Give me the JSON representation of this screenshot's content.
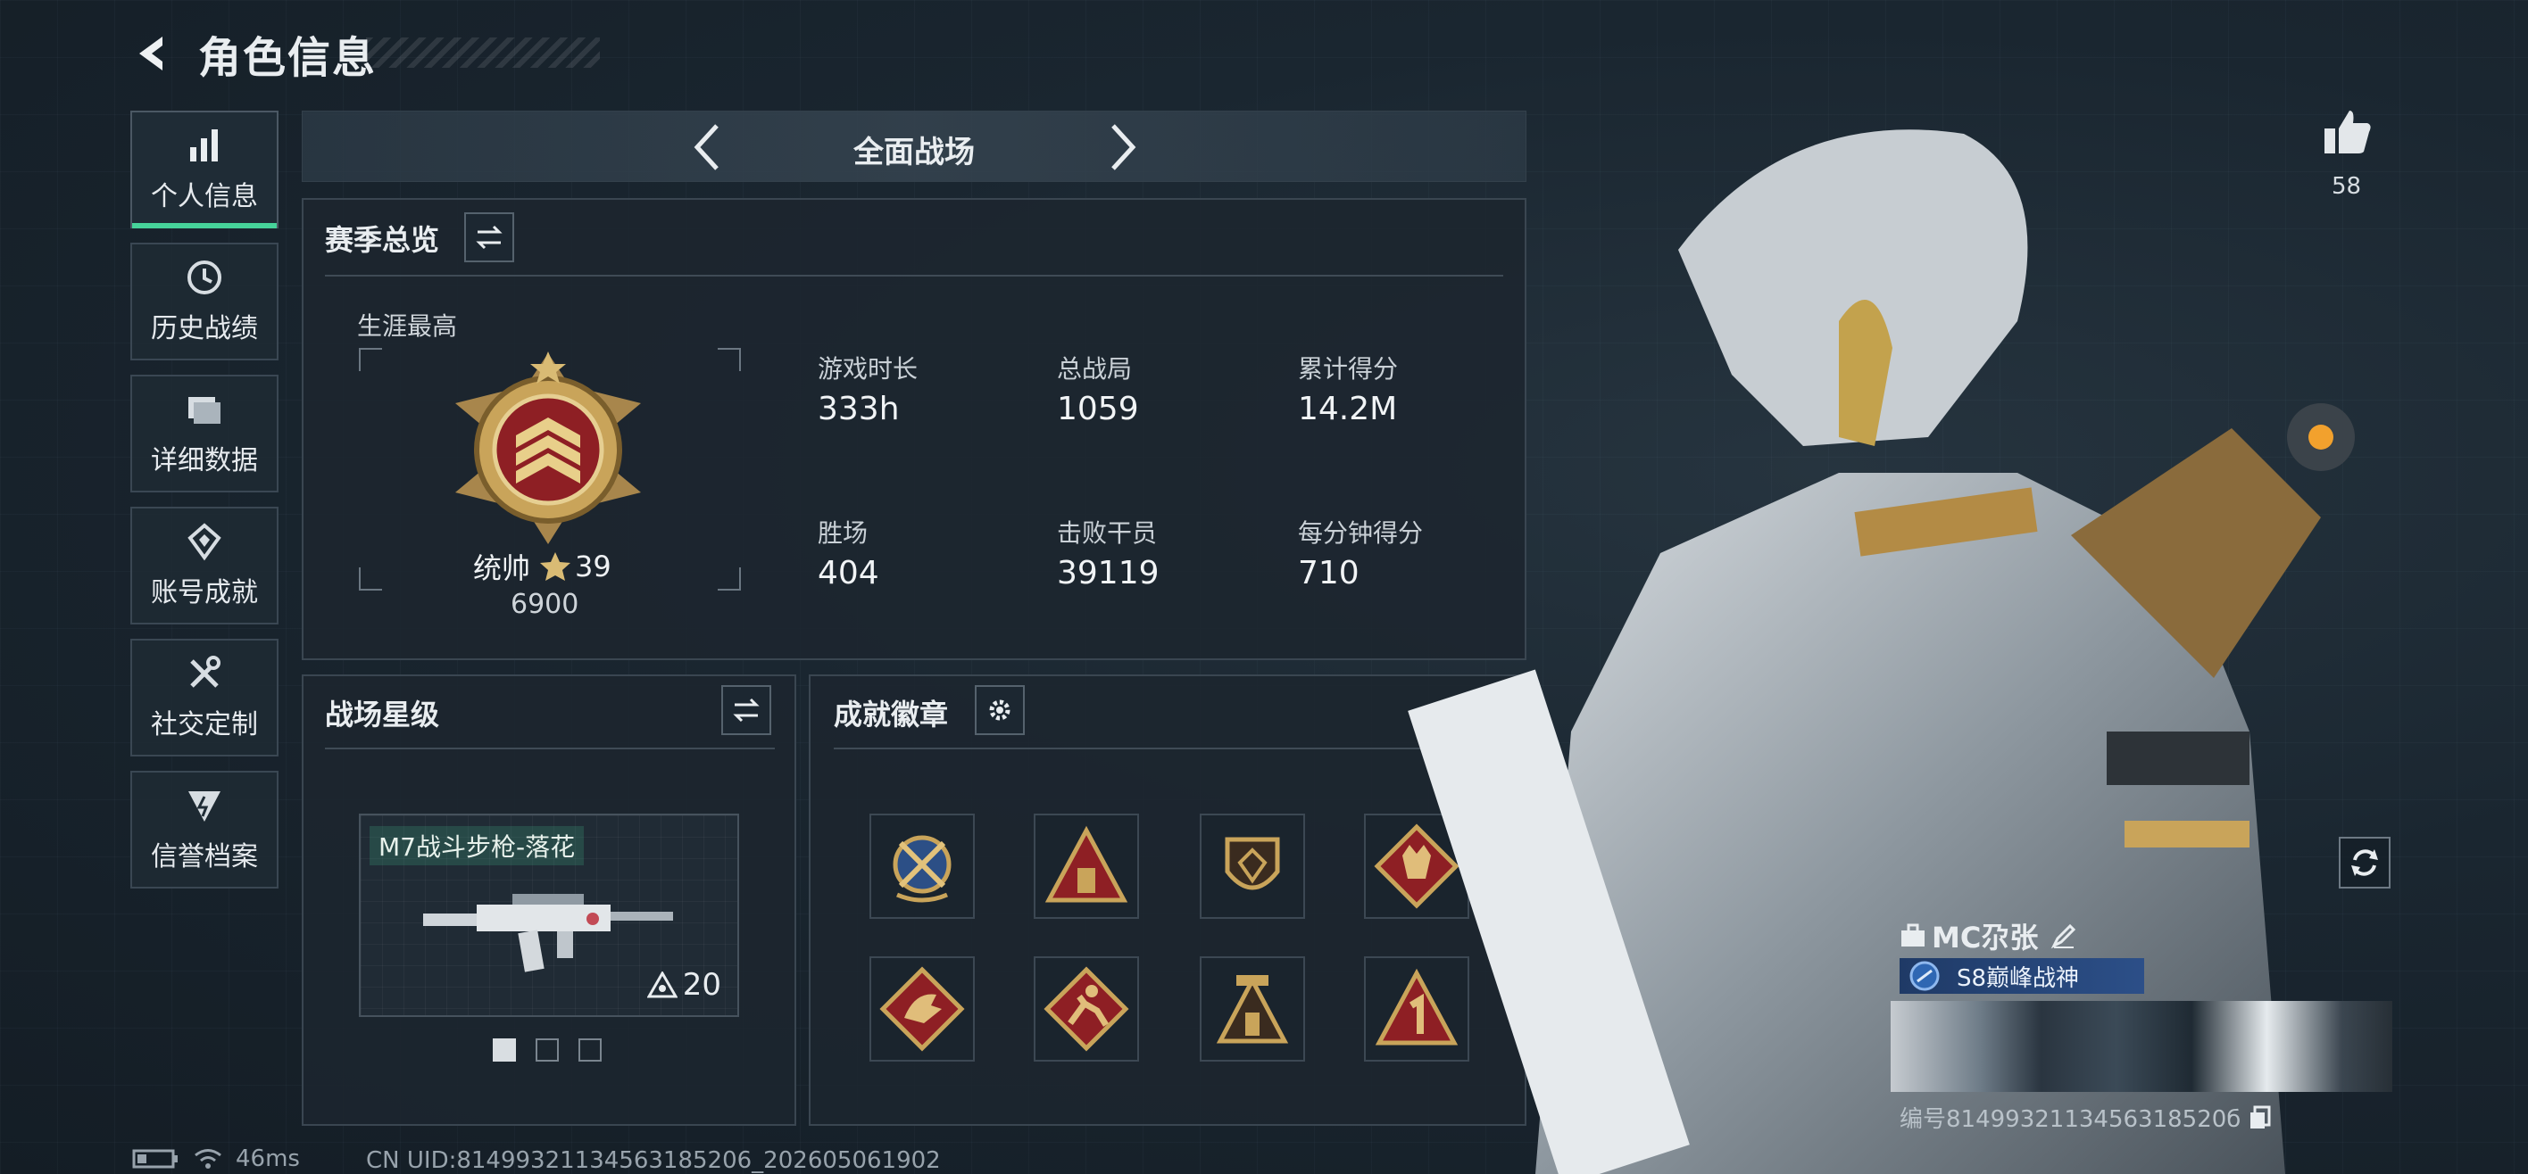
{
  "header": {
    "title": "角色信息"
  },
  "sidebar": {
    "items": [
      {
        "label": "个人信息",
        "icon": "bar-chart-icon",
        "active": true
      },
      {
        "label": "历史战绩",
        "icon": "history-icon"
      },
      {
        "label": "详细数据",
        "icon": "folder-icon"
      },
      {
        "label": "账号成就",
        "icon": "achievement-icon"
      },
      {
        "label": "社交定制",
        "icon": "tools-icon"
      },
      {
        "label": "信誉档案",
        "icon": "shield-icon"
      }
    ]
  },
  "mode": {
    "title": "全面战场"
  },
  "overview": {
    "title": "赛季总览",
    "career_label": "生涯最高",
    "rank_name": "统帅",
    "rank_stars": "39",
    "rank_points": "6900",
    "stats": [
      {
        "label": "游戏时长",
        "value": "333h"
      },
      {
        "label": "总战局",
        "value": "1059"
      },
      {
        "label": "累计得分",
        "value": "14.2M"
      },
      {
        "label": "胜场",
        "value": "404"
      },
      {
        "label": "击败干员",
        "value": "39119"
      },
      {
        "label": "每分钟得分",
        "value": "710"
      }
    ]
  },
  "star_level": {
    "title": "战场星级",
    "weapon_name": "M7战斗步枪-落花",
    "weapon_level": "20"
  },
  "achievements": {
    "title": "成就徽章"
  },
  "profile": {
    "likes": "58",
    "player_name": "MC尕张",
    "title_badge": "S8巅峰战神",
    "id_text": "编号8149932113456318520б"
  },
  "footer": {
    "ping": "46ms",
    "uid": "CN UID:81499321134563185206_202605061902"
  },
  "colors": {
    "accent": "#46d39a",
    "gold": "#c9a45a",
    "badge_red": "#8e1f24"
  }
}
